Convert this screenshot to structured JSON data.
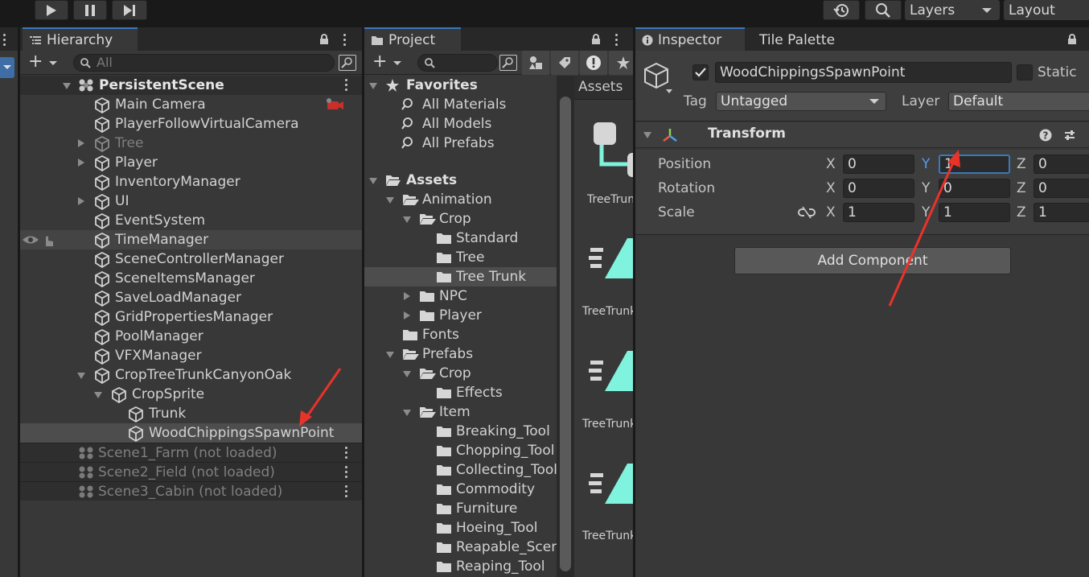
{
  "toolbar": {
    "layers_label": "Layers",
    "layout_label": "Layout"
  },
  "hierarchy": {
    "tab_label": "Hierarchy",
    "search_placeholder": "All",
    "scene_name": "PersistentScene",
    "items": [
      {
        "label": "Main Camera"
      },
      {
        "label": "PlayerFollowVirtualCamera"
      },
      {
        "label": "Tree"
      },
      {
        "label": "Player"
      },
      {
        "label": "InventoryManager"
      },
      {
        "label": "UI"
      },
      {
        "label": "EventSystem"
      },
      {
        "label": "TimeManager"
      },
      {
        "label": "SceneControllerManager"
      },
      {
        "label": "SceneItemsManager"
      },
      {
        "label": "SaveLoadManager"
      },
      {
        "label": "GridPropertiesManager"
      },
      {
        "label": "PoolManager"
      },
      {
        "label": "VFXManager"
      },
      {
        "label": "CropTreeTrunkCanyonOak"
      },
      {
        "label": "CropSprite"
      },
      {
        "label": "Trunk"
      },
      {
        "label": "WoodChippingsSpawnPoint"
      }
    ],
    "unloaded_scenes": [
      {
        "label": "Scene1_Farm (not loaded)"
      },
      {
        "label": "Scene2_Field (not loaded)"
      },
      {
        "label": "Scene3_Cabin (not loaded)"
      }
    ]
  },
  "project": {
    "tab_label": "Project",
    "favorites_label": "Favorites",
    "favorites": [
      {
        "label": "All Materials"
      },
      {
        "label": "All Models"
      },
      {
        "label": "All Prefabs"
      }
    ],
    "assets_label": "Assets",
    "folders": [
      {
        "label": "Animation"
      },
      {
        "label": "Crop"
      },
      {
        "label": "Standard"
      },
      {
        "label": "Tree"
      },
      {
        "label": "Tree Trunk"
      },
      {
        "label": "NPC"
      },
      {
        "label": "Player"
      },
      {
        "label": "Fonts"
      },
      {
        "label": "Prefabs"
      },
      {
        "label": "Crop"
      },
      {
        "label": "Effects"
      },
      {
        "label": "Item"
      },
      {
        "label": "Breaking_Tool"
      },
      {
        "label": "Chopping_Tool"
      },
      {
        "label": "Collecting_Tool"
      },
      {
        "label": "Commodity"
      },
      {
        "label": "Furniture"
      },
      {
        "label": "Hoeing_Tool"
      },
      {
        "label": "Reapable_Scenary"
      },
      {
        "label": "Reaping_Tool"
      }
    ],
    "breadcrumb": "Assets",
    "grid_items": [
      {
        "label": "TreeTrunk"
      },
      {
        "label": "TreeTrunk"
      },
      {
        "label": "TreeTrunk"
      },
      {
        "label": "TreeTrunk"
      }
    ],
    "accent_color": "#7ff3dd"
  },
  "inspector": {
    "tab_label": "Inspector",
    "tile_palette_tab": "Tile Palette",
    "object_name": "WoodChippingsSpawnPoint",
    "static_label": "Static",
    "tag_label": "Tag",
    "tag_value": "Untagged",
    "layer_label": "Layer",
    "layer_value": "Default",
    "transform_label": "Transform",
    "position_label": "Position",
    "rotation_label": "Rotation",
    "scale_label": "Scale",
    "axis_x": "X",
    "axis_y": "Y",
    "axis_z": "Z",
    "position": {
      "x": "0",
      "y": "1",
      "z": "0"
    },
    "rotation": {
      "x": "0",
      "y": "0",
      "z": "0"
    },
    "scale": {
      "x": "1",
      "y": "1",
      "z": "1"
    },
    "add_component_label": "Add Component",
    "focus_color": "#3a79bb",
    "annotation_color": "#e8332a"
  }
}
